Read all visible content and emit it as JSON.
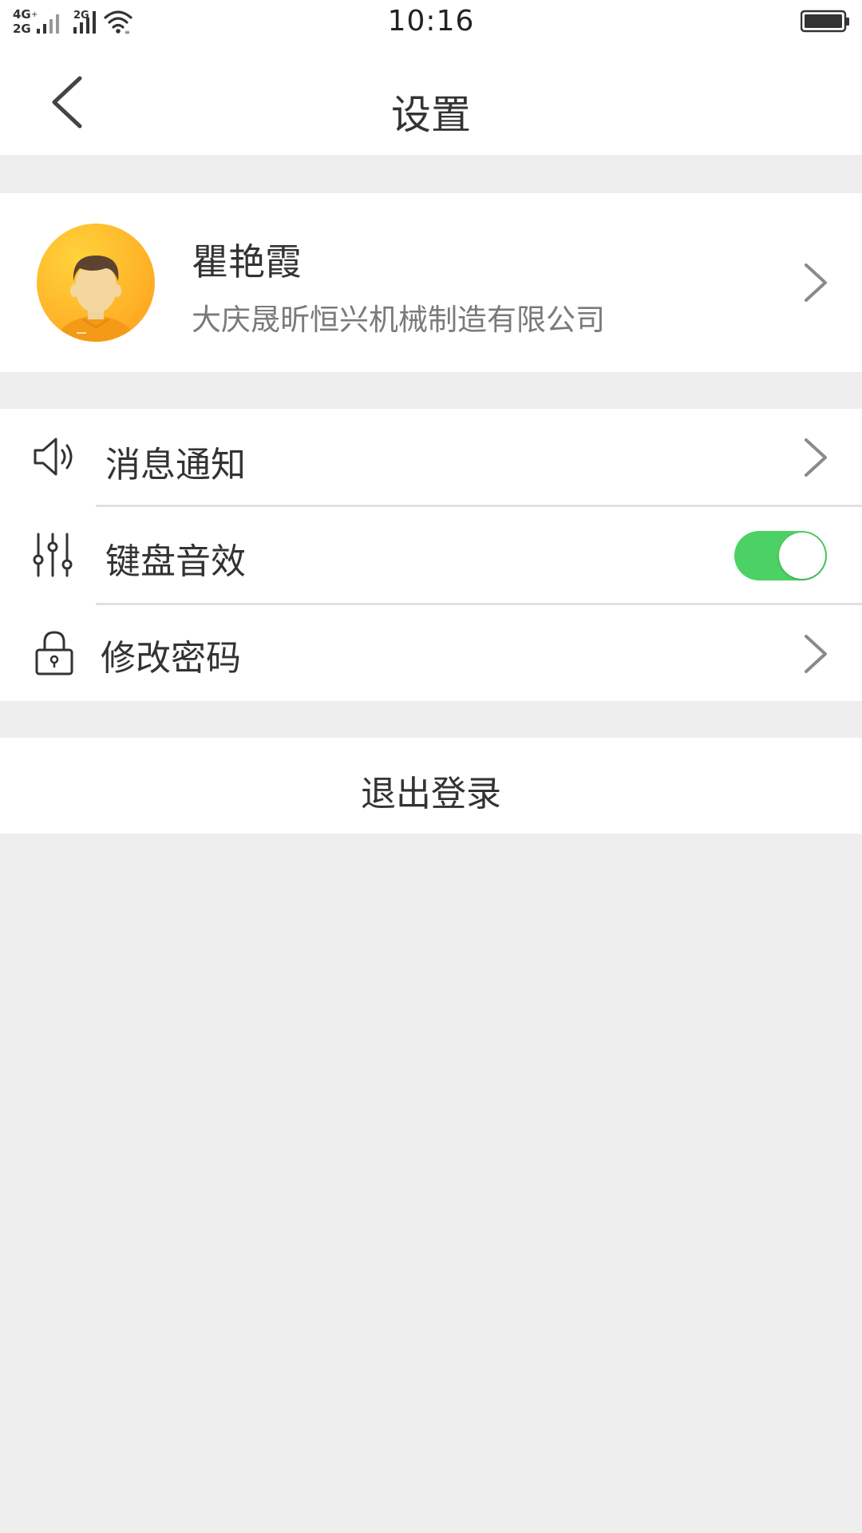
{
  "status_bar": {
    "network_1": "4G",
    "network_2": "2G",
    "network_3": "2G",
    "time": "10:16",
    "icons": [
      "signal-icon",
      "wifi-icon",
      "battery-icon"
    ]
  },
  "header": {
    "title": "设置",
    "back_icon": "chevron-left-icon"
  },
  "profile": {
    "name": "瞿艳霞",
    "company": "大庆晟昕恒兴机械制造有限公司",
    "avatar_icon": "user-avatar-icon"
  },
  "settings": {
    "items": [
      {
        "label": "消息通知",
        "icon": "speaker-icon",
        "control": "chevron"
      },
      {
        "label": "键盘音效",
        "icon": "sliders-icon",
        "control": "toggle",
        "toggle_on": true
      },
      {
        "label": "修改密码",
        "icon": "lock-icon",
        "control": "chevron"
      }
    ]
  },
  "logout": {
    "label": "退出登录"
  },
  "colors": {
    "background": "#eeeeee",
    "card": "#ffffff",
    "toggle_on": "#4cd264",
    "avatar": "#ffb62a",
    "text_primary": "#333333",
    "text_secondary": "#7a7a7a"
  }
}
